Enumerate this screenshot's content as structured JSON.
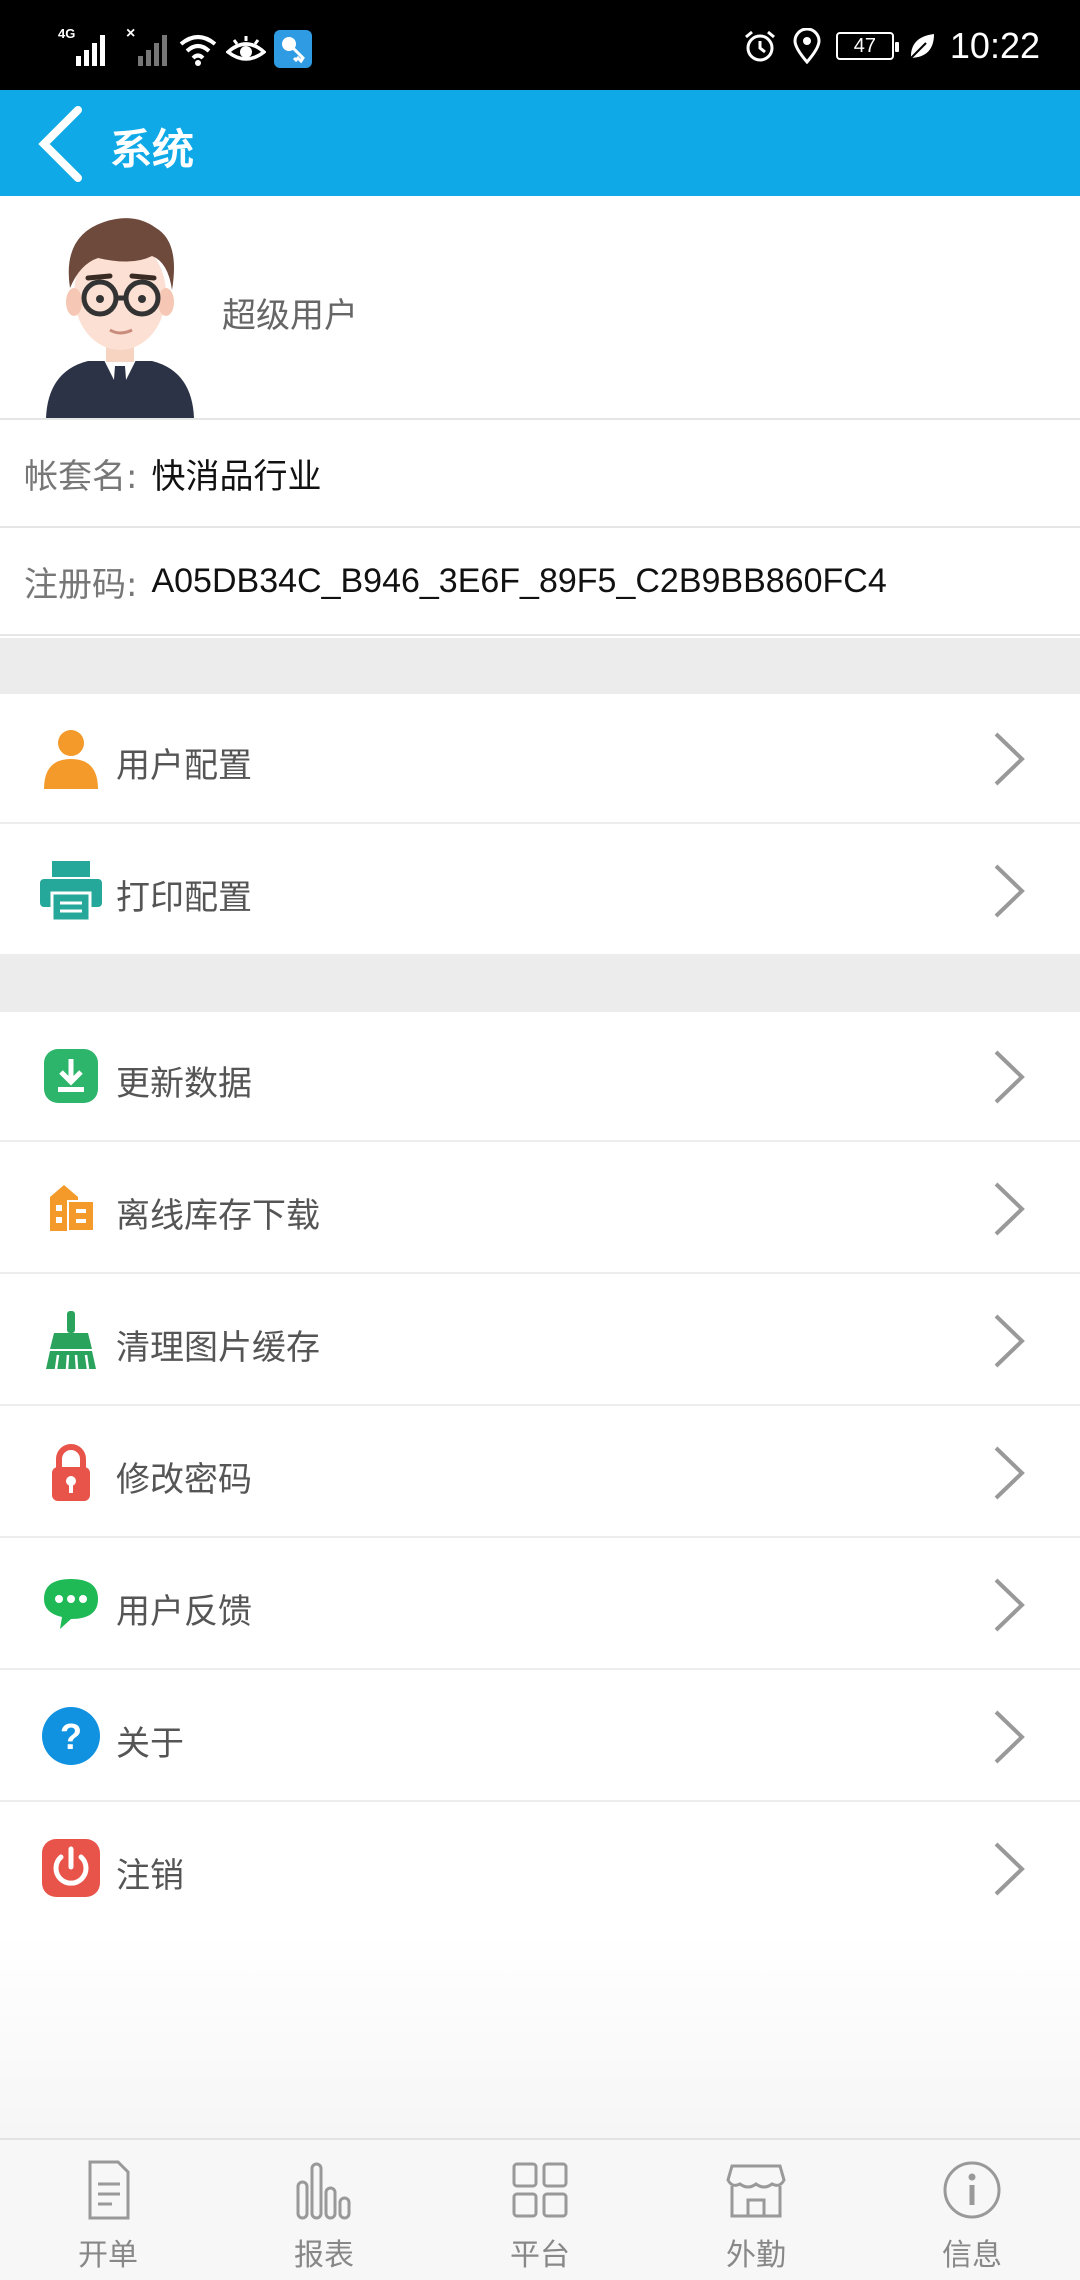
{
  "status_bar": {
    "network": "4G",
    "battery": "47",
    "time": "10:22"
  },
  "header": {
    "title": "系统"
  },
  "profile": {
    "user_name": "超级用户"
  },
  "account": {
    "set_label": "帐套名:",
    "set_value": "快消品行业",
    "reg_label": "注册码:",
    "reg_value": "A05DB34C_B946_3E6F_89F5_C2B9BB860FC4"
  },
  "menu_group1": [
    {
      "label": "用户配置",
      "icon": "user-icon"
    },
    {
      "label": "打印配置",
      "icon": "printer-icon"
    }
  ],
  "menu_group2": [
    {
      "label": "更新数据",
      "icon": "download-icon"
    },
    {
      "label": "离线库存下载",
      "icon": "warehouse-icon"
    },
    {
      "label": "清理图片缓存",
      "icon": "broom-icon"
    },
    {
      "label": "修改密码",
      "icon": "lock-icon"
    },
    {
      "label": "用户反馈",
      "icon": "chat-icon"
    },
    {
      "label": "关于",
      "icon": "question-icon"
    },
    {
      "label": "注销",
      "icon": "power-icon"
    }
  ],
  "tabs": [
    {
      "label": "开单",
      "icon": "document-icon"
    },
    {
      "label": "报表",
      "icon": "bar-chart-icon"
    },
    {
      "label": "平台",
      "icon": "grid-icon"
    },
    {
      "label": "外勤",
      "icon": "store-icon"
    },
    {
      "label": "信息",
      "icon": "info-icon"
    }
  ],
  "colors": {
    "header": "#0fa9e8",
    "user_icon": "#f39a2b",
    "printer_icon": "#25a89a",
    "download_icon": "#2db56b",
    "warehouse_icon": "#f39a2b",
    "broom_icon": "#2aa35c",
    "lock_icon": "#e8534a",
    "chat_icon": "#1fb956",
    "question_icon": "#1192e0",
    "power_icon": "#e8534a"
  }
}
